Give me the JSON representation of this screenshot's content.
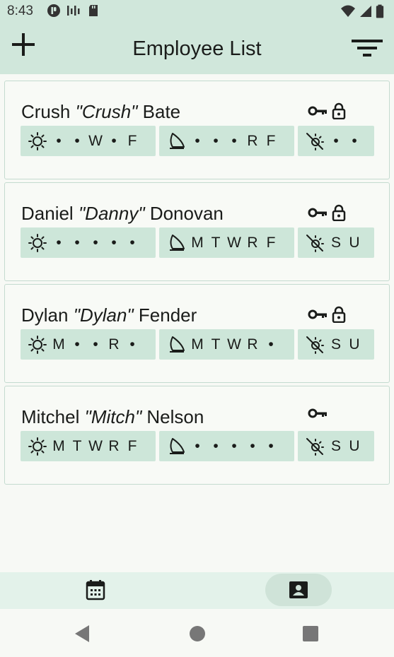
{
  "status_bar": {
    "time": "8:43",
    "left_icons": [
      "p-badge-icon",
      "signal-bars-icon",
      "sd-card-icon"
    ],
    "right_icons": [
      "wifi-icon",
      "cell-signal-icon",
      "battery-icon"
    ]
  },
  "app_bar": {
    "title": "Employee List",
    "add_icon": "plus-icon",
    "filter_icon": "filter-icon"
  },
  "colors": {
    "app_bar_bg": "#d0e7db",
    "chip_bg": "#cde6d9",
    "card_border": "#c4dbcf",
    "page_bg": "#f7f9f5"
  },
  "employees": [
    {
      "first": "Crush",
      "nick": "\"Crush\"",
      "last": "Bate",
      "has_key": true,
      "has_lock": true,
      "day": [
        "•",
        "•",
        "W",
        "•",
        "F"
      ],
      "night": [
        "•",
        "•",
        "•",
        "R",
        "F"
      ],
      "weekend": [
        "•",
        "•"
      ]
    },
    {
      "first": "Daniel",
      "nick": "\"Danny\"",
      "last": "Donovan",
      "has_key": true,
      "has_lock": true,
      "day": [
        "•",
        "•",
        "•",
        "•",
        "•"
      ],
      "night": [
        "M",
        "T",
        "W",
        "R",
        "F"
      ],
      "weekend": [
        "S",
        "U"
      ]
    },
    {
      "first": "Dylan",
      "nick": "\"Dylan\"",
      "last": "Fender",
      "has_key": true,
      "has_lock": true,
      "day": [
        "M",
        "•",
        "•",
        "R",
        "•"
      ],
      "night": [
        "M",
        "T",
        "W",
        "R",
        "•"
      ],
      "weekend": [
        "S",
        "U"
      ]
    },
    {
      "first": "Mitchel",
      "nick": "\"Mitch\"",
      "last": "Nelson",
      "has_key": true,
      "has_lock": false,
      "day": [
        "M",
        "T",
        "W",
        "R",
        "F"
      ],
      "night": [
        "•",
        "•",
        "•",
        "•",
        "•"
      ],
      "weekend": [
        "S",
        "U"
      ]
    }
  ],
  "bottom_nav": {
    "items": [
      {
        "icon": "calendar-icon",
        "selected": false
      },
      {
        "icon": "contact-card-icon",
        "selected": true
      }
    ]
  },
  "system_nav": [
    "back-icon",
    "home-icon",
    "recents-icon"
  ]
}
